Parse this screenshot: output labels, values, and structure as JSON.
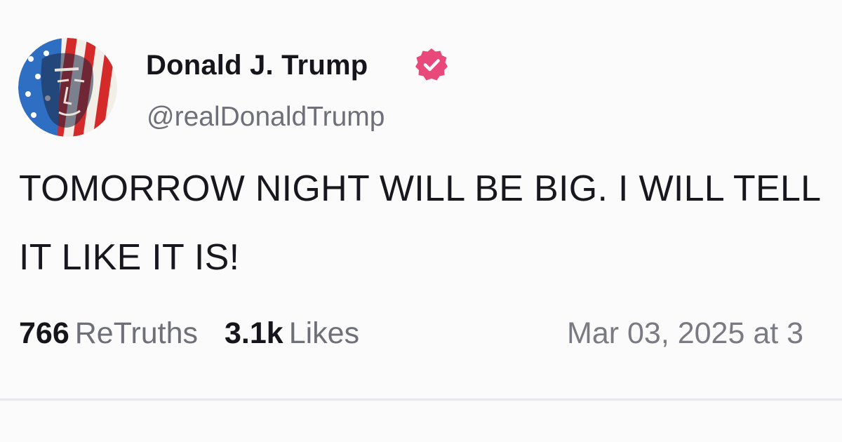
{
  "post": {
    "author": {
      "display_name": "Donald J. Trump",
      "handle": "@realDonaldTrump",
      "verified": true,
      "verified_icon": "verified-badge-icon",
      "avatar": "avatar-image"
    },
    "text_lines": [
      "TOMORROW NIGHT WILL BE BIG. I WILL TELL",
      "IT LIKE IT IS!"
    ],
    "stats": {
      "retruths_count": "766",
      "retruths_label": "ReTruths",
      "likes_count": "3.1k",
      "likes_label": "Likes"
    },
    "timestamp": "Mar 03, 2025 at 3"
  },
  "colors": {
    "background": "#fbfbfb",
    "text_primary": "#16161d",
    "text_secondary": "#6f6f78",
    "verified_badge": "#e8497a",
    "divider": "#e8e8ec"
  }
}
